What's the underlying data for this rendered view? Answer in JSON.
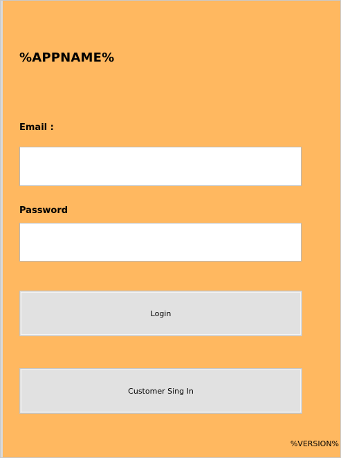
{
  "app": {
    "title": "%APPNAME%",
    "version": "%VERSION%"
  },
  "form": {
    "email_label": "Email :",
    "email_value": "",
    "password_label": "Password",
    "password_value": ""
  },
  "buttons": {
    "login_label": "Login",
    "customer_label": "Customer Sing In"
  },
  "colors": {
    "background": "#ffb860",
    "button": "#e1e1e1",
    "field": "#ffffff"
  }
}
